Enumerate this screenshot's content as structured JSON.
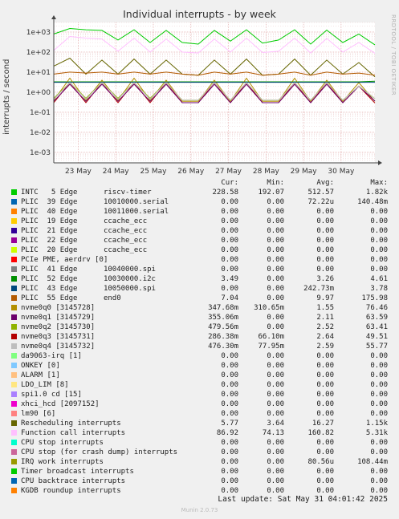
{
  "title": "Individual interrupts - by week",
  "watermark": "RRDTOOL / TOBI OETIKER",
  "footer": {
    "last_update": "Last update: Sat May 31 04:01:42 2025",
    "version": "Munin 2.0.73"
  },
  "legend_headers": {
    "cur": "Cur:",
    "min": "Min:",
    "avg": "Avg:",
    "max": "Max:"
  },
  "legend": [
    {
      "name": "INTC   5 Edge      riscv-timer",
      "color": "#00cc00",
      "cur": "228.58",
      "min": "192.07",
      "avg": "512.57",
      "max": "1.82k"
    },
    {
      "name": "PLIC  39 Edge      10010000.serial",
      "color": "#0066b3",
      "cur": "0.00",
      "min": "0.00",
      "avg": "72.22u",
      "max": "140.48m"
    },
    {
      "name": "PLIC  40 Edge      10011000.serial",
      "color": "#ff8000",
      "cur": "0.00",
      "min": "0.00",
      "avg": "0.00",
      "max": "0.00"
    },
    {
      "name": "PLIC  19 Edge      ccache_ecc",
      "color": "#ffcc00",
      "cur": "0.00",
      "min": "0.00",
      "avg": "0.00",
      "max": "0.00"
    },
    {
      "name": "PLIC  21 Edge      ccache_ecc",
      "color": "#330099",
      "cur": "0.00",
      "min": "0.00",
      "avg": "0.00",
      "max": "0.00"
    },
    {
      "name": "PLIC  22 Edge      ccache_ecc",
      "color": "#990099",
      "cur": "0.00",
      "min": "0.00",
      "avg": "0.00",
      "max": "0.00"
    },
    {
      "name": "PLIC  20 Edge      ccache_ecc",
      "color": "#ccff00",
      "cur": "0.00",
      "min": "0.00",
      "avg": "0.00",
      "max": "0.00"
    },
    {
      "name": "PCIe PME, aerdrv [0]",
      "color": "#ff0000",
      "cur": "0.00",
      "min": "0.00",
      "avg": "0.00",
      "max": "0.00"
    },
    {
      "name": "PLIC  41 Edge      10040000.spi",
      "color": "#808080",
      "cur": "0.00",
      "min": "0.00",
      "avg": "0.00",
      "max": "0.00"
    },
    {
      "name": "PLIC  52 Edge      10030000.i2c",
      "color": "#008f00",
      "cur": "3.49",
      "min": "0.00",
      "avg": "3.26",
      "max": "4.61"
    },
    {
      "name": "PLIC  43 Edge      10050000.spi",
      "color": "#00487d",
      "cur": "0.00",
      "min": "0.00",
      "avg": "242.73m",
      "max": "3.78"
    },
    {
      "name": "PLIC  55 Edge      end0",
      "color": "#b35a00",
      "cur": "7.04",
      "min": "0.00",
      "avg": "9.97",
      "max": "175.98"
    },
    {
      "name": "nvme0q0 [3145728]",
      "color": "#b38f00",
      "cur": "347.68m",
      "min": "310.65m",
      "avg": "1.55",
      "max": "76.46"
    },
    {
      "name": "nvme0q1 [3145729]",
      "color": "#6b006b",
      "cur": "355.06m",
      "min": "0.00",
      "avg": "2.11",
      "max": "63.59"
    },
    {
      "name": "nvme0q2 [3145730]",
      "color": "#8fb300",
      "cur": "479.56m",
      "min": "0.00",
      "avg": "2.52",
      "max": "63.41"
    },
    {
      "name": "nvme0q3 [3145731]",
      "color": "#b30000",
      "cur": "286.38m",
      "min": "66.10m",
      "avg": "2.64",
      "max": "49.51"
    },
    {
      "name": "nvme0q4 [3145732]",
      "color": "#bebebe",
      "cur": "476.30m",
      "min": "77.95m",
      "avg": "2.59",
      "max": "55.77"
    },
    {
      "name": "da9063-irq [1]",
      "color": "#80ff80",
      "cur": "0.00",
      "min": "0.00",
      "avg": "0.00",
      "max": "0.00"
    },
    {
      "name": "ONKEY [0]",
      "color": "#80c9ff",
      "cur": "0.00",
      "min": "0.00",
      "avg": "0.00",
      "max": "0.00"
    },
    {
      "name": "ALARM [1]",
      "color": "#ffc080",
      "cur": "0.00",
      "min": "0.00",
      "avg": "0.00",
      "max": "0.00"
    },
    {
      "name": "LDO_LIM [8]",
      "color": "#ffe680",
      "cur": "0.00",
      "min": "0.00",
      "avg": "0.00",
      "max": "0.00"
    },
    {
      "name": "spi1.0 cd [15]",
      "color": "#aa80ff",
      "cur": "0.00",
      "min": "0.00",
      "avg": "0.00",
      "max": "0.00"
    },
    {
      "name": "xhci_hcd [2097152]",
      "color": "#ee00cc",
      "cur": "0.00",
      "min": "0.00",
      "avg": "0.00",
      "max": "0.00"
    },
    {
      "name": "lm90 [6]",
      "color": "#ff8080",
      "cur": "0.00",
      "min": "0.00",
      "avg": "0.00",
      "max": "0.00"
    },
    {
      "name": "Rescheduling interrupts",
      "color": "#666600",
      "cur": "5.77",
      "min": "3.64",
      "avg": "16.27",
      "max": "1.15k"
    },
    {
      "name": "Function call interrupts",
      "color": "#ffbfff",
      "cur": "86.92",
      "min": "74.13",
      "avg": "160.82",
      "max": "5.31k"
    },
    {
      "name": "CPU stop interrupts",
      "color": "#00ffcc",
      "cur": "0.00",
      "min": "0.00",
      "avg": "0.00",
      "max": "0.00"
    },
    {
      "name": "CPU stop (for crash dump) interrupts",
      "color": "#cc6699",
      "cur": "0.00",
      "min": "0.00",
      "avg": "0.00",
      "max": "0.00"
    },
    {
      "name": "IRQ work interrupts",
      "color": "#999900",
      "cur": "0.00",
      "min": "0.00",
      "avg": "80.56u",
      "max": "108.44m"
    },
    {
      "name": "Timer broadcast interrupts",
      "color": "#00cc00",
      "cur": "0.00",
      "min": "0.00",
      "avg": "0.00",
      "max": "0.00"
    },
    {
      "name": "CPU backtrace interrupts",
      "color": "#0066b3",
      "cur": "0.00",
      "min": "0.00",
      "avg": "0.00",
      "max": "0.00"
    },
    {
      "name": "KGDB roundup interrupts",
      "color": "#ff8000",
      "cur": "0.00",
      "min": "0.00",
      "avg": "0.00",
      "max": "0.00"
    }
  ],
  "chart_data": {
    "type": "line",
    "title": "Individual interrupts - by week",
    "ylabel": "interrupts / second",
    "yscale": "log",
    "ylim": [
      0.0003,
      3000
    ],
    "y_ticks": [
      "1e-03",
      "1e-02",
      "1e-01",
      "1e+00",
      "1e+01",
      "1e+02",
      "1e+03"
    ],
    "x_ticks": [
      "23 May",
      "24 May",
      "25 May",
      "26 May",
      "27 May",
      "28 May",
      "29 May",
      "30 May"
    ],
    "grid": true,
    "series": [
      {
        "name": "INTC   5 Edge      riscv-timer",
        "color": "#00cc00",
        "values": [
          800,
          1500,
          1300,
          1200,
          400,
          1300,
          300,
          1200,
          300,
          250,
          1200,
          350,
          1300,
          280,
          400,
          1300,
          250,
          1250,
          300,
          800,
          229
        ]
      },
      {
        "name": "Function call interrupts",
        "color": "#ffbfff",
        "values": [
          120,
          600,
          500,
          450,
          110,
          500,
          100,
          450,
          100,
          90,
          450,
          100,
          500,
          95,
          110,
          500,
          90,
          480,
          100,
          300,
          87
        ]
      },
      {
        "name": "Rescheduling interrupts",
        "color": "#666600",
        "values": [
          20,
          50,
          8,
          40,
          8,
          45,
          8,
          40,
          8,
          7,
          40,
          8,
          45,
          7,
          8,
          45,
          7,
          40,
          8,
          30,
          5.8
        ]
      },
      {
        "name": "PLIC  55 Edge      end0",
        "color": "#b35a00",
        "values": [
          8,
          10,
          9,
          10,
          8,
          10,
          8,
          10,
          8,
          7,
          10,
          8,
          10,
          7,
          8,
          10,
          7,
          10,
          8,
          9,
          7
        ]
      },
      {
        "name": "PLIC  52 Edge      10030000.i2c",
        "color": "#008f00",
        "values": [
          3.3,
          3.3,
          3.3,
          3.3,
          3.3,
          3.3,
          3.3,
          3.3,
          3.3,
          3.3,
          3.3,
          3.3,
          3.3,
          3.3,
          3.3,
          3.3,
          3.3,
          3.3,
          3.3,
          3.3,
          3.5
        ]
      },
      {
        "name": "nvme0q0 [3145728]",
        "color": "#b38f00",
        "values": [
          0.4,
          5,
          0.4,
          4,
          0.4,
          5,
          0.4,
          4,
          0.35,
          0.35,
          4,
          0.35,
          5,
          0.35,
          0.35,
          5,
          0.35,
          4,
          0.35,
          3,
          0.35
        ]
      },
      {
        "name": "nvme0q2 [3145730]",
        "color": "#8fb300",
        "values": [
          0.5,
          3,
          0.5,
          3,
          0.5,
          3,
          0.5,
          3,
          0.4,
          0.4,
          3,
          0.4,
          3,
          0.4,
          0.4,
          3,
          0.4,
          3,
          0.4,
          2,
          0.48
        ]
      },
      {
        "name": "nvme0q3 [3145731]",
        "color": "#b30000",
        "values": [
          0.3,
          3,
          0.3,
          3,
          0.3,
          3,
          0.3,
          3,
          0.3,
          0.3,
          3,
          0.3,
          3,
          0.3,
          0.3,
          3,
          0.3,
          3,
          0.3,
          2,
          0.29
        ]
      },
      {
        "name": "nvme0q1 [3145729]",
        "color": "#6b006b",
        "values": [
          0.35,
          2.5,
          0.35,
          2.5,
          0.35,
          2.5,
          0.35,
          2.5,
          0.3,
          0.3,
          2.5,
          0.3,
          2.5,
          0.3,
          0.3,
          2.5,
          0.3,
          2.5,
          0.3,
          2,
          0.36
        ]
      },
      {
        "name": "PLIC  43 Edge      10050000.spi",
        "color": "#00487d",
        "values": [
          3.1,
          3.1,
          3.1,
          3.1,
          3.1,
          3.1,
          3.1,
          3.1,
          3.1,
          3.1,
          3.1,
          3.1,
          3.1,
          3.1,
          3.1,
          3.1,
          3.1,
          3.1,
          3.1,
          3.1,
          3.1
        ]
      },
      {
        "name": "nvme0q4 [3145732]",
        "color": "#bebebe",
        "values": [
          0.45,
          3,
          0.45,
          3,
          0.45,
          3,
          0.45,
          3,
          0.4,
          0.4,
          3,
          0.4,
          3,
          0.4,
          0.4,
          3,
          0.4,
          3,
          0.4,
          2,
          0.48
        ]
      }
    ]
  }
}
